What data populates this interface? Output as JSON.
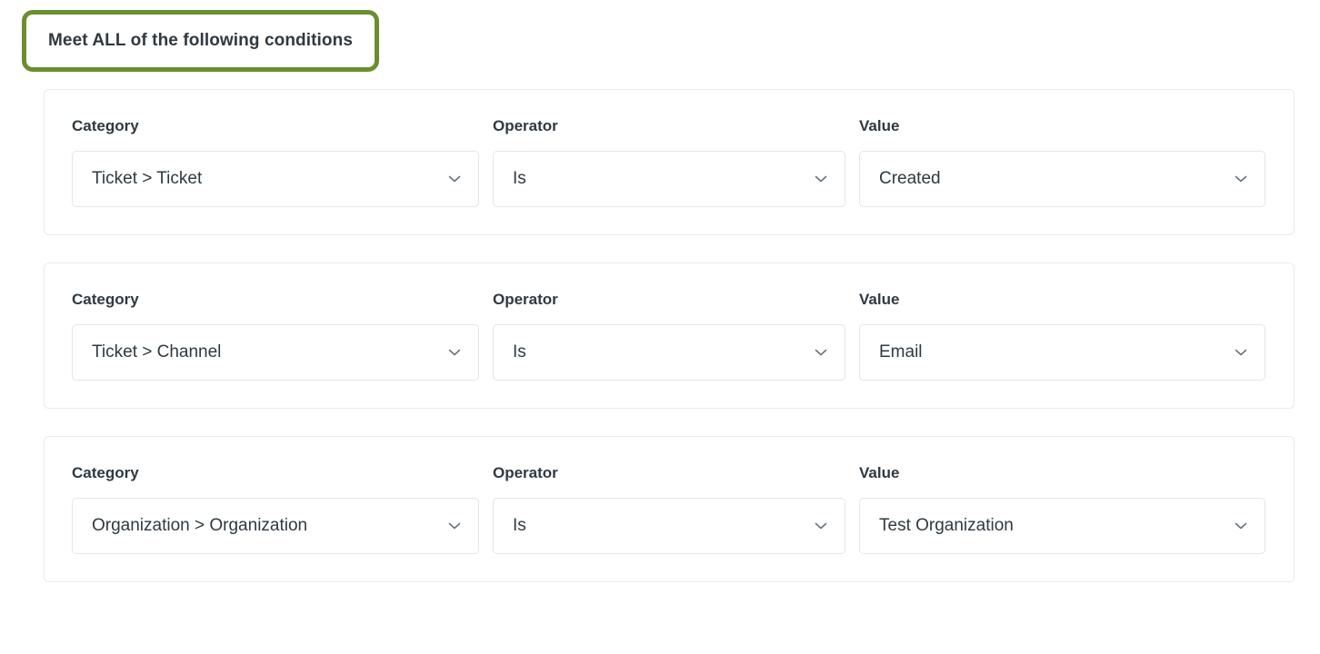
{
  "header": {
    "match_badge_label": "Meet ALL of the following conditions",
    "badge_border_color": "#6b8e2e"
  },
  "labels": {
    "category": "Category",
    "operator": "Operator",
    "value": "Value"
  },
  "icons": {
    "chevron": "chevron-down-icon"
  },
  "conditions": [
    {
      "category": "Ticket > Ticket",
      "operator": "Is",
      "value": "Created"
    },
    {
      "category": "Ticket > Channel",
      "operator": "Is",
      "value": "Email"
    },
    {
      "category": "Organization > Organization",
      "operator": "Is",
      "value": "Test Organization"
    }
  ]
}
